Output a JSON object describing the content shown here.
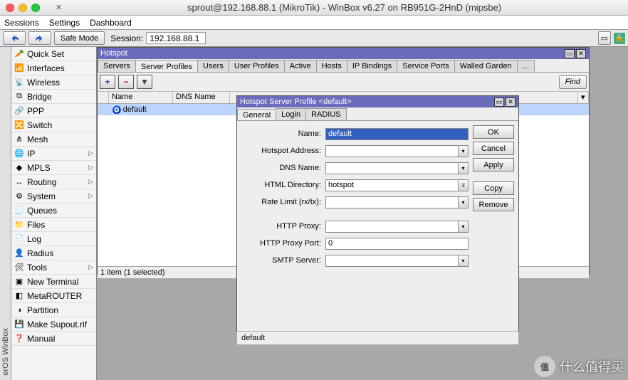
{
  "title": "sprout@192.168.88.1 (MikroTik) - WinBox v6.27 on RB951G-2HnD (mipsbe)",
  "menu": [
    "Sessions",
    "Settings",
    "Dashboard"
  ],
  "toolbar": {
    "safe_mode": "Safe Mode",
    "session_label": "Session:",
    "session_value": "192.168.88.1"
  },
  "sidebar": [
    {
      "icon": "🥕",
      "label": "Quick Set"
    },
    {
      "icon": "📶",
      "label": "Interfaces"
    },
    {
      "icon": "📡",
      "label": "Wireless"
    },
    {
      "icon": "⧉",
      "label": "Bridge"
    },
    {
      "icon": "🔗",
      "label": "PPP"
    },
    {
      "icon": "🔀",
      "label": "Switch"
    },
    {
      "icon": "⋔",
      "label": "Mesh"
    },
    {
      "icon": "🌐",
      "label": "IP",
      "sub": true
    },
    {
      "icon": "◆",
      "label": "MPLS",
      "sub": true
    },
    {
      "icon": "↔",
      "label": "Routing",
      "sub": true
    },
    {
      "icon": "⚙",
      "label": "System",
      "sub": true
    },
    {
      "icon": "🧾",
      "label": "Queues"
    },
    {
      "icon": "📁",
      "label": "Files"
    },
    {
      "icon": "📄",
      "label": "Log"
    },
    {
      "icon": "👤",
      "label": "Radius"
    },
    {
      "icon": "🛠",
      "label": "Tools",
      "sub": true
    },
    {
      "icon": "▣",
      "label": "New Terminal"
    },
    {
      "icon": "◧",
      "label": "MetaROUTER"
    },
    {
      "icon": "◑",
      "label": "Partition"
    },
    {
      "icon": "💾",
      "label": "Make Supout.rif"
    },
    {
      "icon": "❓",
      "label": "Manual"
    }
  ],
  "vlabel": "erOS WinBox",
  "hotspot": {
    "title": "Hotspot",
    "tabs": [
      "Servers",
      "Server Profiles",
      "Users",
      "User Profiles",
      "Active",
      "Hosts",
      "IP Bindings",
      "Service Ports",
      "Walled Garden",
      "..."
    ],
    "active_tab": "Server Profiles",
    "find": "Find",
    "cols": [
      "Name",
      "DNS Name"
    ],
    "row": {
      "name": "default"
    },
    "status": "1 item (1 selected)"
  },
  "dialog": {
    "title": "Hotspot Server Profile <default>",
    "tabs": [
      "General",
      "Login",
      "RADIUS"
    ],
    "active": "General",
    "fields": {
      "name_l": "Name:",
      "name": "default",
      "addr_l": "Hotspot Address:",
      "addr": "",
      "dns_l": "DNS Name:",
      "dns": "",
      "html_l": "HTML Directory:",
      "html": "hotspot",
      "rate_l": "Rate Limit (rx/tx):",
      "rate": "",
      "proxy_l": "HTTP Proxy:",
      "proxy": "",
      "pport_l": "HTTP Proxy Port:",
      "pport": "0",
      "smtp_l": "SMTP Server:",
      "smtp": ""
    },
    "buttons": [
      "OK",
      "Cancel",
      "Apply",
      "Copy",
      "Remove"
    ],
    "footer": "default"
  },
  "watermark": "什么值得买"
}
